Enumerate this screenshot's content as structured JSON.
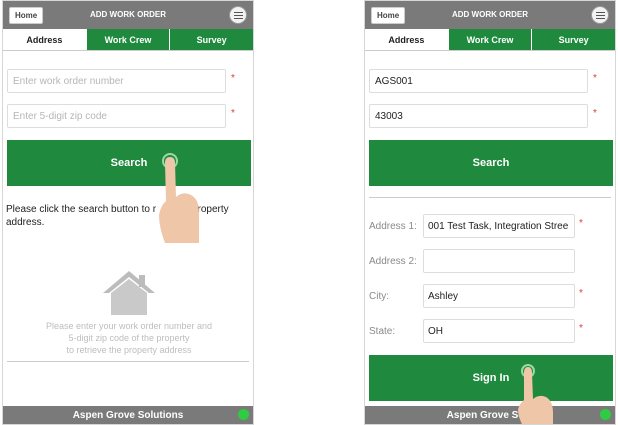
{
  "colors": {
    "accent": "#1f8a3d",
    "topbar": "#7a7a7a",
    "status_dot": "#2ecc40"
  },
  "screens": [
    {
      "topbar": {
        "home_label": "Home",
        "title": "ADD WORK ORDER",
        "menu_icon": "menu-icon"
      },
      "tabs": [
        "Address",
        "Work Crew",
        "Survey"
      ],
      "work_order": {
        "placeholder": "Enter work order number",
        "value": ""
      },
      "zip": {
        "placeholder": "Enter 5-digit zip code",
        "value": ""
      },
      "search_label": "Search",
      "instruction_part1": "Please click the search button to r",
      "instruction_part2": "he property",
      "instruction_part3": "address.",
      "empty_state": {
        "icon": "house-icon",
        "line1": "Please enter your work order number and",
        "line2": "5-digit zip code of the property",
        "line3": "to retrieve the property address"
      },
      "footer": "Aspen Grove Solutions"
    },
    {
      "topbar": {
        "home_label": "Home",
        "title": "ADD WORK ORDER",
        "menu_icon": "menu-icon"
      },
      "tabs": [
        "Address",
        "Work Crew",
        "Survey"
      ],
      "work_order": {
        "value": "AGS001"
      },
      "zip": {
        "value": "43003"
      },
      "search_label": "Search",
      "address1": {
        "label": "Address 1:",
        "value": "001 Test Task, Integration Stree"
      },
      "address2": {
        "label": "Address 2:",
        "value": ""
      },
      "city": {
        "label": "City:",
        "value": "Ashley"
      },
      "state": {
        "label": "State:",
        "value": "OH"
      },
      "sign_in_label": "Sign In",
      "footer": "Aspen Grove Solu"
    }
  ]
}
